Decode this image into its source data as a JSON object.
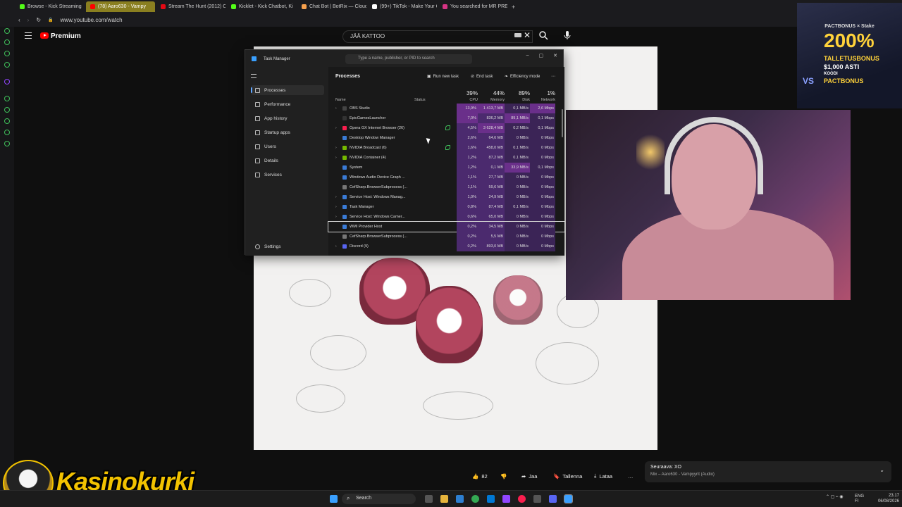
{
  "browser": {
    "tabs": [
      {
        "label": "Browse - Kick Streaming",
        "color": "#53fc18"
      },
      {
        "label": "(78) Aaro630 - Vampy",
        "color": "#ff0000",
        "active": true
      },
      {
        "label": "Stream The Hunt (2012) O",
        "color": "#e50914"
      },
      {
        "label": "Kicklet - Kick Chatbot, Ki",
        "color": "#53fc18"
      },
      {
        "label": "Chat Bot | BotRix — Cloud",
        "color": "#f6a04d"
      },
      {
        "label": "(99+) TikTok - Make Your C",
        "color": "#ffffff"
      },
      {
        "label": "You searched for MR PRES",
        "color": "#d63384"
      }
    ],
    "new_tab": "+",
    "url": "www.youtube.com/watch"
  },
  "youtube": {
    "brand": "Premium",
    "search_value": "JÄÄ KATTOO",
    "actions": {
      "likes": "82",
      "share": "Jaa",
      "save": "Tallenna",
      "download": "Lataa",
      "more": "…"
    },
    "next": {
      "heading": "Seuraava: XO",
      "sub": "Mix – Aaro630 - Vampyyrit (Audio)"
    }
  },
  "ad": {
    "brand_line": "PACTBONUS × Stake",
    "big": "200%",
    "line1": "TALLETUSBONUS",
    "line2": "$1,000 ASTI",
    "code_label": "KOODI",
    "code": "PACTBONUS",
    "tag": "VS"
  },
  "overlay": {
    "logo_text": "Kasinokurki"
  },
  "taskmanager": {
    "title": "Task Manager",
    "search_placeholder": "Type a name, publisher, or PID to search",
    "nav": [
      {
        "label": "Processes",
        "icon": "grid-icon"
      },
      {
        "label": "Performance",
        "icon": "chart-icon"
      },
      {
        "label": "App history",
        "icon": "history-icon"
      },
      {
        "label": "Startup apps",
        "icon": "startup-icon"
      },
      {
        "label": "Users",
        "icon": "users-icon"
      },
      {
        "label": "Details",
        "icon": "list-icon"
      },
      {
        "label": "Services",
        "icon": "gear-icon"
      }
    ],
    "settings": "Settings",
    "page_title": "Processes",
    "toolbar": {
      "run_new_task": "Run new task",
      "end_task": "End task",
      "efficiency_mode": "Efficiency mode",
      "more": "⋯"
    },
    "columns": {
      "name": "Name",
      "status": "Status",
      "cpu": "CPU",
      "memory": "Memory",
      "disk": "Disk",
      "network": "Network"
    },
    "totals": {
      "cpu": "39%",
      "memory": "44%",
      "disk": "89%",
      "network": "1%"
    },
    "processes": [
      {
        "name": "OBS Studio",
        "expand": true,
        "cpu": "13,9%",
        "mem": "1 413,7 MB",
        "disk": "0,1 MB/s",
        "net": "2,6 Mbps",
        "color": "#444"
      },
      {
        "name": "EpicGamesLauncher",
        "expand": false,
        "cpu": "7,0%",
        "mem": "836,2 MB",
        "disk": "89,1 MB/s",
        "net": "0,1 Mbps",
        "color": "#333"
      },
      {
        "name": "Opera GX Internet Browser (26)",
        "expand": true,
        "cpu": "4,5%",
        "mem": "3 628,4 MB",
        "disk": "0,2 MB/s",
        "net": "0,1 Mbps",
        "color": "#fa1e4e",
        "leaf": true
      },
      {
        "name": "Desktop Window Manager",
        "expand": false,
        "cpu": "2,6%",
        "mem": "64,6 MB",
        "disk": "0 MB/s",
        "net": "0 Mbps",
        "color": "#3a7bd5"
      },
      {
        "name": "NVIDIA Broadcast (6)",
        "expand": true,
        "cpu": "1,6%",
        "mem": "458,0 MB",
        "disk": "0,1 MB/s",
        "net": "0 Mbps",
        "color": "#76b900",
        "leaf": true
      },
      {
        "name": "NVIDIA Container (4)",
        "expand": true,
        "cpu": "1,2%",
        "mem": "87,2 MB",
        "disk": "0,1 MB/s",
        "net": "0 Mbps",
        "color": "#76b900"
      },
      {
        "name": "System",
        "expand": false,
        "cpu": "1,2%",
        "mem": "0,1 MB",
        "disk": "33,9 MB/s",
        "net": "0,1 Mbps",
        "color": "#3a7bd5"
      },
      {
        "name": "Windows Audio Device Graph ...",
        "expand": false,
        "cpu": "1,1%",
        "mem": "27,7 MB",
        "disk": "0 MB/s",
        "net": "0 Mbps",
        "color": "#3a7bd5"
      },
      {
        "name": "CefSharp.BrowserSubprocess (...",
        "expand": false,
        "cpu": "1,1%",
        "mem": "59,6 MB",
        "disk": "0 MB/s",
        "net": "0 Mbps",
        "color": "#777"
      },
      {
        "name": "Service Host: Windows Manag...",
        "expand": true,
        "cpu": "1,0%",
        "mem": "24,9 MB",
        "disk": "0 MB/s",
        "net": "0 Mbps",
        "color": "#3a7bd5"
      },
      {
        "name": "Task Manager",
        "expand": true,
        "cpu": "0,8%",
        "mem": "87,4 MB",
        "disk": "0,1 MB/s",
        "net": "0 Mbps",
        "color": "#3a7bd5"
      },
      {
        "name": "Service Host: Windows Camer...",
        "expand": true,
        "cpu": "0,6%",
        "mem": "65,0 MB",
        "disk": "0 MB/s",
        "net": "0 Mbps",
        "color": "#3a7bd5"
      },
      {
        "name": "WMI Provider Host",
        "expand": false,
        "cpu": "0,2%",
        "mem": "34,5 MB",
        "disk": "0 MB/s",
        "net": "0 Mbps",
        "color": "#3a7bd5",
        "selected": true
      },
      {
        "name": "CefSharp.BrowserSubprocess (...",
        "expand": false,
        "cpu": "0,2%",
        "mem": "5,5 MB",
        "disk": "0 MB/s",
        "net": "0 Mbps",
        "color": "#777"
      },
      {
        "name": "Discord (9)",
        "expand": true,
        "cpu": "0,2%",
        "mem": "893,0 MB",
        "disk": "0 MB/s",
        "net": "0 Mbps",
        "color": "#5865f2"
      }
    ]
  },
  "taskbar": {
    "search_label": "Search",
    "lang": "ENG",
    "region": "FI",
    "time": "23.17",
    "date": "06/08/2026"
  }
}
